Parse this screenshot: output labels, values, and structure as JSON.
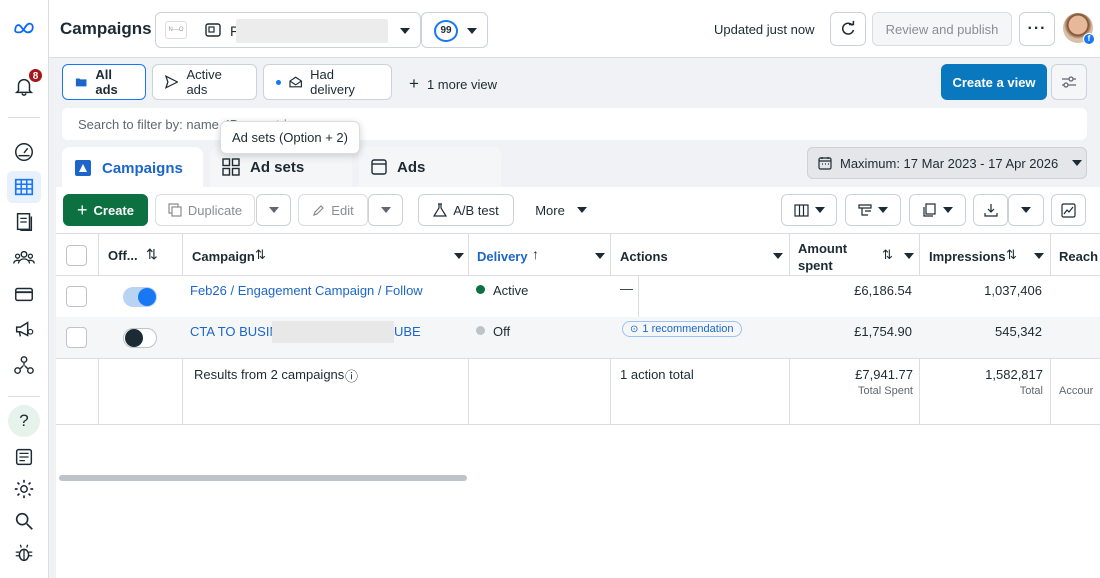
{
  "header": {
    "title": "Campaigns",
    "account_logo_text": "N—O",
    "account_name_visible": "F",
    "opportunity_score": "99",
    "updated_text": "Updated just now",
    "review_publish_label": "Review and publish",
    "more_label": "···",
    "avatar_badge": "f"
  },
  "rail": {
    "notification_count": "8"
  },
  "views": {
    "items": [
      {
        "label": "All ads"
      },
      {
        "label": "Active ads"
      },
      {
        "label": "Had delivery"
      }
    ],
    "more_views_label": "1 more view",
    "create_view_label": "Create a view"
  },
  "search": {
    "placeholder": "Search to filter by: name, ID or metrics"
  },
  "tooltip": {
    "text": "Ad sets (Option + 2)"
  },
  "tabs": [
    {
      "label": "Campaigns"
    },
    {
      "label": "Ad sets"
    },
    {
      "label": "Ads"
    }
  ],
  "date_range": {
    "label": "Maximum: 17 Mar 2023 - 17 Apr 2026"
  },
  "toolbar": {
    "create_label": "Create",
    "duplicate_label": "Duplicate",
    "edit_label": "Edit",
    "ab_test_label": "A/B test",
    "more_label": "More"
  },
  "table": {
    "headers": {
      "off_on": "Off...",
      "campaign": "Campaign",
      "delivery": "Delivery",
      "actions": "Actions",
      "amount_spent_1": "Amount",
      "amount_spent_2": "spent",
      "impressions": "Impressions",
      "reach": "Reach"
    },
    "rows": [
      {
        "toggle_on": true,
        "campaign": "Feb26 / Engagement Campaign / Follow",
        "delivery": "Active",
        "delivery_color": "#0c7040",
        "actions": "—",
        "amount_spent": "£6,186.54",
        "impressions": "1,037,406"
      },
      {
        "toggle_on": false,
        "campaign_start": "CTA TO BUSIN",
        "campaign_end": "UBE",
        "delivery": "Off",
        "delivery_color": "#bec3c9",
        "actions": "1 recommendation",
        "amount_spent": "£1,754.90",
        "impressions": "545,342"
      }
    ],
    "summary": {
      "results_label": "Results from 2 campaigns",
      "info_icon": "ⓘ",
      "actions_total": "1 action total",
      "amount_total": "£7,941.77",
      "amount_sub": "Total Spent",
      "impressions_total": "1,582,817",
      "impressions_sub": "Total",
      "reach_sub": "Accour"
    }
  },
  "colors": {
    "accent_blue": "#1877f2",
    "create_view_bg": "#0a78be",
    "create_green": "#0c7040",
    "link_blue": "#1c66c9"
  }
}
